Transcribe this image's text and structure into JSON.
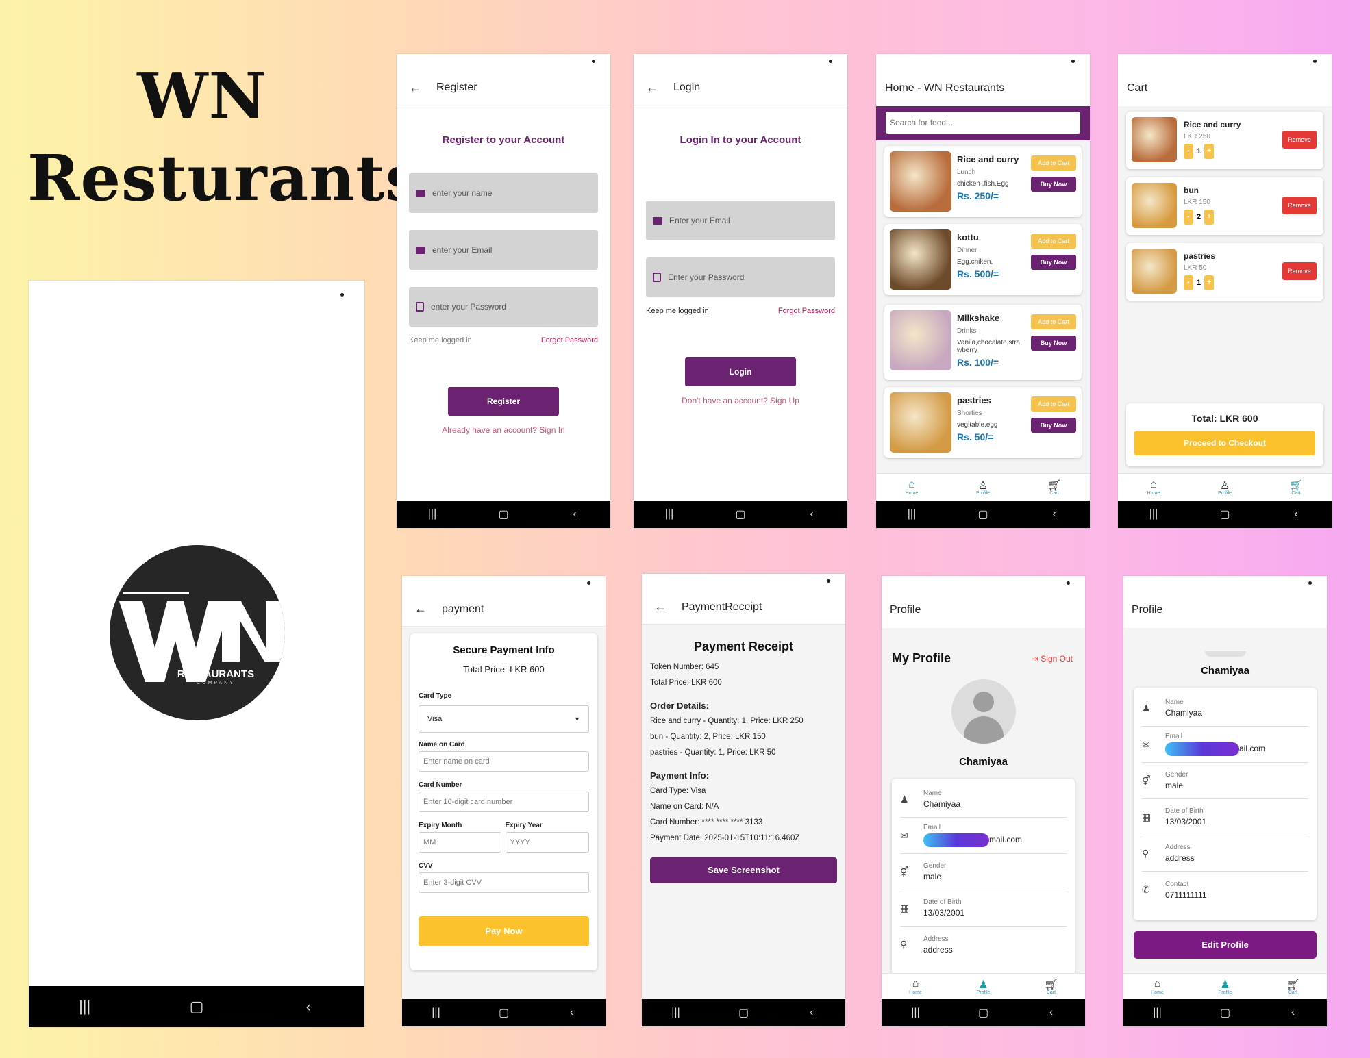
{
  "brand": {
    "title_line1": "WN",
    "title_line2": "Resturants",
    "logo_text": "RESTAURANTS",
    "logo_sub": "COMPANY"
  },
  "register": {
    "title": "Register",
    "heading": "Register to your Account",
    "name_ph": "enter your name",
    "email_ph": "enter your Email",
    "pass_ph": "enter your Password",
    "keep": "Keep me logged in",
    "forgot": "Forgot Password",
    "button": "Register",
    "link": "Already have an account? Sign In"
  },
  "login": {
    "title": "Login",
    "heading": "Login In to your Account",
    "email_ph": "Enter your Email",
    "pass_ph": "Enter your Password",
    "keep": "Keep me logged in",
    "forgot": "Forgot Password",
    "button": "Login",
    "link": "Don't have an account? Sign Up"
  },
  "home": {
    "title": "Home - WN Restaurants",
    "search_ph": "Search for food...",
    "add": "Add to Cart",
    "buy": "Buy Now",
    "items": [
      {
        "name": "Rice and curry",
        "cat": "Lunch",
        "desc": "chicken ,fish,Egg",
        "price": "Rs. 250/="
      },
      {
        "name": "kottu",
        "cat": "Dinner",
        "desc": "Egg,chiken,",
        "price": "Rs. 500/="
      },
      {
        "name": "Milkshake",
        "cat": "Drinks",
        "desc": "Vanila,chocalate,stra wberry",
        "price": "Rs. 100/="
      },
      {
        "name": "pastries",
        "cat": "Shorties",
        "desc": "vegitable,egg",
        "price": "Rs. 50/="
      }
    ]
  },
  "nav": {
    "home": "Home",
    "profile": "Profile",
    "cart": "Cart"
  },
  "cart": {
    "title": "Cart",
    "remove": "Remove",
    "items": [
      {
        "name": "Rice and curry",
        "price": "LKR 250",
        "qty": "1"
      },
      {
        "name": "bun",
        "price": "LKR 150",
        "qty": "2"
      },
      {
        "name": "pastries",
        "price": "LKR 50",
        "qty": "1"
      }
    ],
    "minus": "-",
    "plus": "+",
    "total": "Total: LKR 600",
    "checkout": "Proceed to Checkout"
  },
  "payment": {
    "title": "payment",
    "heading": "Secure Payment Info",
    "total": "Total Price: LKR 600",
    "card_type_label": "Card Type",
    "card_type": "Visa",
    "name_label": "Name on Card",
    "name_ph": "Enter name on card",
    "num_label": "Card Number",
    "num_ph": "Enter 16-digit card number",
    "month_label": "Expiry Month",
    "month_ph": "MM",
    "year_label": "Expiry Year",
    "year_ph": "YYYY",
    "cvv_label": "CVV",
    "cvv_ph": "Enter 3-digit CVV",
    "button": "Pay Now"
  },
  "receipt": {
    "title": "PaymentReceipt",
    "heading": "Payment Receipt",
    "token": "Token Number: 645",
    "total": "Total Price: LKR 600",
    "order_h": "Order Details:",
    "o1": "Rice and curry - Quantity: 1, Price: LKR 250",
    "o2": "bun - Quantity: 2, Price: LKR 150",
    "o3": "pastries  - Quantity: 1, Price: LKR 50",
    "pay_h": "Payment Info:",
    "p1": "Card Type: Visa",
    "p2": "Name on Card: N/A",
    "p3": "Card Number: **** **** **** 3133",
    "p4": "Payment Date: 2025-01-15T10:11:16.460Z",
    "button": "Save Screenshot"
  },
  "profile": {
    "title": "Profile",
    "heading": "My Profile",
    "signout": "Sign Out",
    "user": "Chamiyaa",
    "name_k": "Name",
    "name_v": "Chamiyaa",
    "email_k": "Email",
    "email_v": "ail.com",
    "email_v2": "mail.com",
    "gender_k": "Gender",
    "gender_v": "male",
    "dob_k": "Date of Birth",
    "dob_v": "13/03/2001",
    "addr_k": "Address",
    "addr_v": "address",
    "contact_k": "Contact",
    "contact_v": "0711111111",
    "edit": "Edit Profile"
  }
}
